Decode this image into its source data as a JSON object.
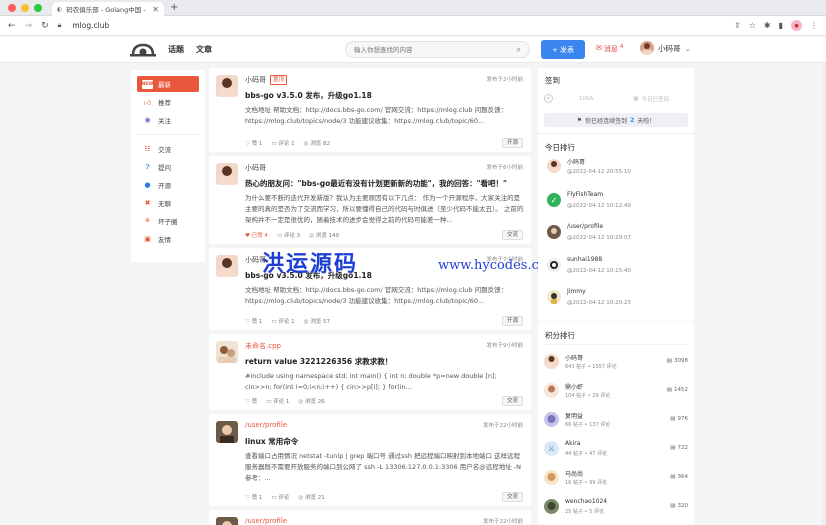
{
  "browser": {
    "tab_title": "码农俱乐部 - Golang中国 - Go语",
    "url": "mlog.club",
    "traffic_colors": [
      "#fe5f57",
      "#febc2e",
      "#28c840"
    ]
  },
  "header": {
    "nav": [
      "话题",
      "文章"
    ],
    "search_placeholder": "输入你想查找的内容",
    "publish_label": "+ 发表",
    "messages_label": "消息",
    "messages_count": "4",
    "username": "小码哥"
  },
  "leftnav": {
    "items": [
      {
        "label": "最新",
        "icon": "new-badge-icon",
        "active": true
      },
      {
        "label": "推荐",
        "icon": "thumbs-up-icon"
      },
      {
        "label": "关注",
        "icon": "eye-icon"
      },
      {
        "label": "交流",
        "icon": "chat-icon"
      },
      {
        "label": "提问",
        "icon": "question-icon"
      },
      {
        "label": "开源",
        "icon": "github-icon"
      },
      {
        "label": "无聊",
        "icon": "bored-icon"
      },
      {
        "label": "坏子圈",
        "icon": "circle-icon"
      },
      {
        "label": "友情",
        "icon": "link-icon"
      }
    ]
  },
  "posts": [
    {
      "author": "小码哥",
      "tag": "置顶",
      "time": "发布于2小时前",
      "title": "bbs-go v3.5.0 发布，升级go1.18",
      "body": "文档地址  帮助文档：http://docs.bbs-go.com/ 官网交流：https://mlog.club 问题反馈：https://mlog.club/topics/node/3 功能建议收集：https://mlog.club/topic/60...",
      "likes": "赞 1",
      "comments": "评论 1",
      "views": "浏览 82",
      "node": "开源",
      "liked": false
    },
    {
      "author": "小码哥",
      "time": "发布于6小时前",
      "title": "热心的朋友问：\"bbs-go最近有没有计划更新新的功能\"，我的回答：\"看吧！\"",
      "body": "为什么要不断的迭代开发新版？我认为主要原因有以下几点： 作为一个开源程序，大家关注的是主要的真的是否为了交流而学习，所以要懂得自己的代码与时俱进（至少代码不能太丑）。 之前的架构并不一定是很优的，随着技术的进步会觉得之前的代码可能差一种...",
      "likes": "已赞 4",
      "comments": "评论 3",
      "views": "浏览 149",
      "node": "交流",
      "liked": true
    },
    {
      "author": "小码哥",
      "time": "发布于7小时前",
      "title": "bbs-go v3.5.0 发布，升级go1.18",
      "body": "文档地址  帮助文档：http://docs.bbs-go.com/ 官网交流：https://mlog.club 问题反馈：https://mlog.club/topics/node/3 功能建议收集：https://mlog.club/topic/60...",
      "likes": "赞 1",
      "comments": "评论 1",
      "views": "浏览 57",
      "node": "开源",
      "liked": false
    },
    {
      "author": "未命名.cpp",
      "time": "发布于9小时前",
      "title": "return value 3221226356 求教求教！",
      "body": "#include using namespace std; int main() { int n; double *p=new double [n]; cin>>n; for(int i=0;i<n;i++) { cin>>p[i]; } for(in...",
      "likes": "赞",
      "comments": "评论 1",
      "views": "浏览 26",
      "node": "交流",
      "liked": false
    },
    {
      "author": "/user/profile",
      "time": "发布于22小时前",
      "title": "linux 常用命令",
      "body": "查看端口占用情况 netstat -tunlp | grep 端口号 通过ssh 把远程端口映射到本地端口 这样远程服务器既不需要开放服务的端口到公网了 ssh -L 13306:127.0.0.1:3306 用户名@远程地址 -N 参考：...",
      "likes": "赞 1",
      "comments": "评论",
      "views": "浏览 21",
      "node": "交流",
      "liked": false
    },
    {
      "author": "/user/profile",
      "time": "发布于22小时前"
    }
  ],
  "checkin": {
    "title": "签到",
    "score": "100A",
    "today_label": "今日已签到",
    "button_prefix": "你已经连续签到",
    "button_days": "2",
    "button_suffix": "天啦！"
  },
  "today_rank": {
    "title": "今日排行",
    "items": [
      {
        "name": "小码哥",
        "time": "@2022-04-12 20:55:10"
      },
      {
        "name": "FlyFishTeam",
        "time": "@2022-04-12 10:12:49"
      },
      {
        "name": "/user/profile",
        "time": "@2022-04-12 10:29:07"
      },
      {
        "name": "sunhai1988",
        "time": "@2022-04-12 10:15:40"
      },
      {
        "name": "Jimmy",
        "time": "@2022-04-12 10:20:23"
      }
    ]
  },
  "score_rank": {
    "title": "积分排行",
    "items": [
      {
        "name": "小码哥",
        "sub": "643 帖子 • 1557 评论",
        "pts": "3098"
      },
      {
        "name": "鼎小虾",
        "sub": "104 帖子 • 29 评论",
        "pts": "1452"
      },
      {
        "name": "复明益",
        "sub": "66 帖子 • 137 评论",
        "pts": "976"
      },
      {
        "name": "Akira",
        "sub": "44 帖子 • 47 评论",
        "pts": "722"
      },
      {
        "name": "马尚尚",
        "sub": "16 帖子 • 99 评论",
        "pts": "364"
      },
      {
        "name": "wenchao1024",
        "sub": "25 帖子 • 5 评论",
        "pts": "320"
      }
    ]
  },
  "watermark": {
    "cn": "洪运源码",
    "url": "www.hycodes.cn"
  },
  "colors": {
    "accent": "#e9573d",
    "primary": "#3a85f0"
  }
}
